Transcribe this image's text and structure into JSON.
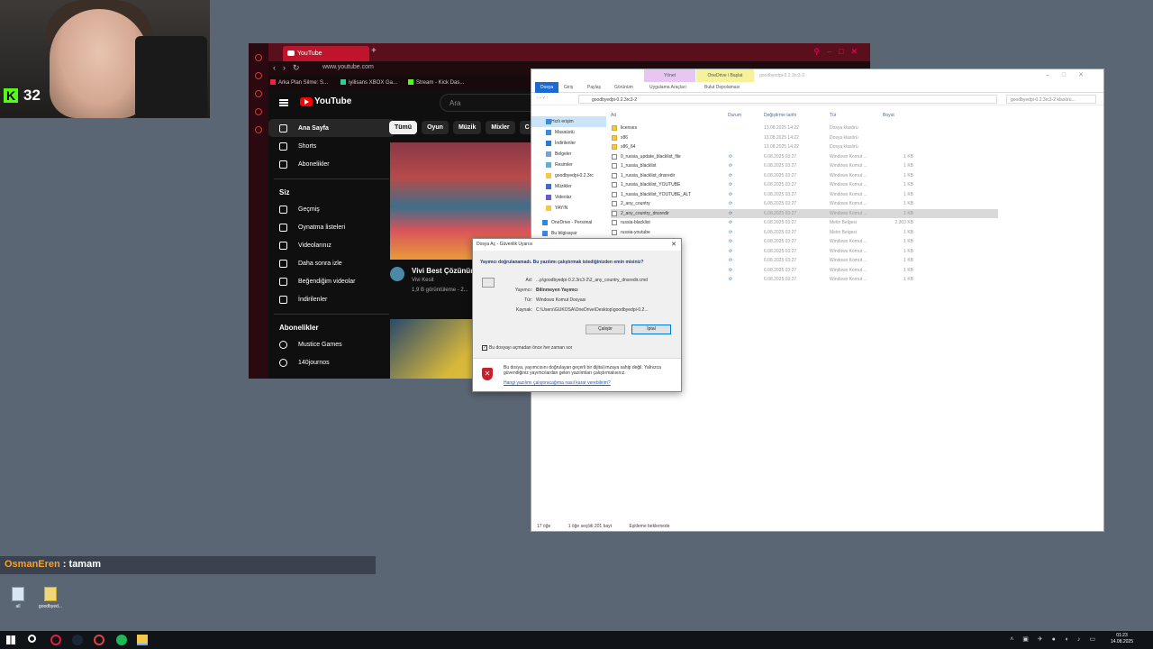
{
  "stream": {
    "viewer_count": "32",
    "chat": {
      "username": "OsmanEren",
      "separator": " : ",
      "message": "tamam"
    }
  },
  "browser": {
    "tab_title": "YouTube",
    "new_tab": "+",
    "url": "www.youtube.com",
    "bookmarks": [
      "Arka Plan Silme: S...",
      "iyilisans XBOX Ga...",
      "Stream - Kick Das..."
    ],
    "youtube": {
      "logo": "YouTube",
      "search_placeholder": "Ara",
      "nav": [
        {
          "label": "Ana Sayfa",
          "icon": "home-icon"
        },
        {
          "label": "Shorts",
          "icon": "shorts-icon"
        },
        {
          "label": "Abonelikler",
          "icon": "subscriptions-icon"
        }
      ],
      "you_section": "Siz",
      "you_items": [
        {
          "label": "Geçmiş",
          "icon": "history-icon"
        },
        {
          "label": "Oynatma listeleri",
          "icon": "playlist-icon"
        },
        {
          "label": "Videolarınız",
          "icon": "your-videos-icon"
        },
        {
          "label": "Daha sonra izle",
          "icon": "watch-later-icon"
        },
        {
          "label": "Beğendiğim videolar",
          "icon": "liked-icon"
        },
        {
          "label": "İndirilenler",
          "icon": "download-icon"
        }
      ],
      "subs_section": "Abonelikler",
      "subs": [
        "Mustice Games",
        "140journos"
      ],
      "chips": [
        "Tümü",
        "Oyun",
        "Müzik",
        "Mixler",
        "C"
      ],
      "video1": {
        "title": "Vivi Best Çözünürlü",
        "channel": "Vivi Kesit",
        "meta": "1,9 B görüntüleme - 2..."
      }
    }
  },
  "explorer": {
    "title_path": "goodbyedpi-0.2.3rc3-2",
    "ribbon_context": {
      "manage": "Yönet",
      "onedrive": "OneDrive i Başlat"
    },
    "ribbon_tabs": [
      "Dosya",
      "Giriş",
      "Paylaş",
      "Görünüm",
      "Uygulama Araçları",
      "Bulut Depolaması"
    ],
    "address": "goodbyedpi-0.2.3rc3-2",
    "search_placeholder": "goodbyedpi-0.2.3rc3-2 klasörü...",
    "nav": [
      {
        "label": "Hızlı erişim",
        "header": true
      },
      {
        "label": "Masaüstü"
      },
      {
        "label": "İndirilenler"
      },
      {
        "label": "Belgeler"
      },
      {
        "label": "Resimler"
      },
      {
        "label": "goodbyedpi-0.2.3rc"
      },
      {
        "label": "Müzikler"
      },
      {
        "label": "Videolar"
      },
      {
        "label": "YAYIN"
      },
      {
        "label": "OneDrive - Personal"
      },
      {
        "label": "Bu bilgisayar"
      }
    ],
    "columns": {
      "name": "Ad",
      "status": "Durum",
      "date": "Değiştirme tarihi",
      "type": "Tür",
      "size": "Boyut"
    },
    "files": [
      {
        "name": "licenses",
        "status": "",
        "date": "13.08.2025 14:22",
        "type": "Dosya klasörü",
        "size": "",
        "folder": true
      },
      {
        "name": "x86",
        "status": "",
        "date": "13.08.2025 14:22",
        "type": "Dosya klasörü",
        "size": "",
        "folder": true
      },
      {
        "name": "x86_64",
        "status": "",
        "date": "13.08.2025 14:22",
        "type": "Dosya klasörü",
        "size": "",
        "folder": true
      },
      {
        "name": "0_russia_update_blacklist_file",
        "status": "sync",
        "date": "6.08.2025 03:27",
        "type": "Windows Komut ...",
        "size": "1 KB"
      },
      {
        "name": "1_russia_blacklist",
        "status": "sync",
        "date": "6.08.2025 03:27",
        "type": "Windows Komut ...",
        "size": "1 KB"
      },
      {
        "name": "1_russia_blacklist_dnsredir",
        "status": "sync",
        "date": "6.08.2025 03:27",
        "type": "Windows Komut ...",
        "size": "1 KB"
      },
      {
        "name": "1_russia_blacklist_YOUTUBE",
        "status": "sync",
        "date": "6.08.2025 03:27",
        "type": "Windows Komut ...",
        "size": "1 KB"
      },
      {
        "name": "1_russia_blacklist_YOUTUBE_ALT",
        "status": "sync",
        "date": "6.08.2025 03:27",
        "type": "Windows Komut ...",
        "size": "1 KB"
      },
      {
        "name": "2_any_country",
        "status": "sync",
        "date": "6.08.2025 03:27",
        "type": "Windows Komut ...",
        "size": "1 KB"
      },
      {
        "name": "2_any_country_dnsredir",
        "status": "sync",
        "date": "6.08.2025 03:27",
        "type": "Windows Komut ...",
        "size": "1 KB",
        "selected": true
      },
      {
        "name": "russia-blacklist",
        "status": "sync",
        "date": "6.08.2025 03:27",
        "type": "Metin Belgesi",
        "size": "2.303 KB"
      },
      {
        "name": "russia-youtube",
        "status": "sync",
        "date": "6.08.2025 03:27",
        "type": "Metin Belgesi",
        "size": "1 KB"
      },
      {
        "name": "",
        "status": "sync",
        "date": "6.08.2025 03:27",
        "type": "Windows Komut ...",
        "size": "1 KB"
      },
      {
        "name": "...list_dnsredir",
        "status": "sync",
        "date": "6.08.2025 03:27",
        "type": "Windows Komut ...",
        "size": "1 KB"
      },
      {
        "name": "...list_YOUTUBE",
        "status": "sync",
        "date": "6.08.2025 03:27",
        "type": "Windows Komut ...",
        "size": "1 KB"
      },
      {
        "name": "...list_YOUTUBE...",
        "status": "sync",
        "date": "6.08.2025 03:27",
        "type": "Windows Komut ...",
        "size": "1 KB"
      },
      {
        "name": "",
        "status": "sync",
        "date": "6.08.2025 03:27",
        "type": "Windows Komut ...",
        "size": "1 KB"
      }
    ],
    "status_bar": [
      "17 öğe",
      "1 öğe seçildi 201 bayt",
      "Eşitleme beklemede"
    ]
  },
  "dialog": {
    "title": "Dosya Aç - Güvenlik Uyarısı",
    "question": "Yayımcı doğrulanamadı. Bu yazılımı çalıştırmak istediğinizden emin misiniz?",
    "fields": [
      {
        "key": "Ad:",
        "value": "...p\\goodbyedpi-0.2.3rc3-2\\2_any_country_dnsredir.cmd"
      },
      {
        "key": "Yayımcı:",
        "value": "Bilinmeyen Yayımcı"
      },
      {
        "key": "Tür:",
        "value": "Windows Komut Dosyası"
      },
      {
        "key": "Kaynak:",
        "value": "C:\\Users\\GUKOSA\\OneDrive\\Desktop\\goodbyedpi-0.2..."
      }
    ],
    "run_button": "Çalıştır",
    "cancel_button": "İptal",
    "checkbox": "Bu dosyayı açmadan önce her zaman sor",
    "warning": "Bu dosya, yayımcısını doğrulayan geçerli bir dijital imzaya sahip değil. Yalnızca güvendiğiniz yayımcılardan gelen yazılımları çalıştırmalısınız.",
    "link": "Hangi yazılımı çalıştıracağıma nasıl karar verebilirim?"
  },
  "desktop": {
    "icons": [
      "all",
      "goodbyed..."
    ]
  },
  "taskbar": {
    "time": "01:23",
    "date": "14.08.2025"
  }
}
